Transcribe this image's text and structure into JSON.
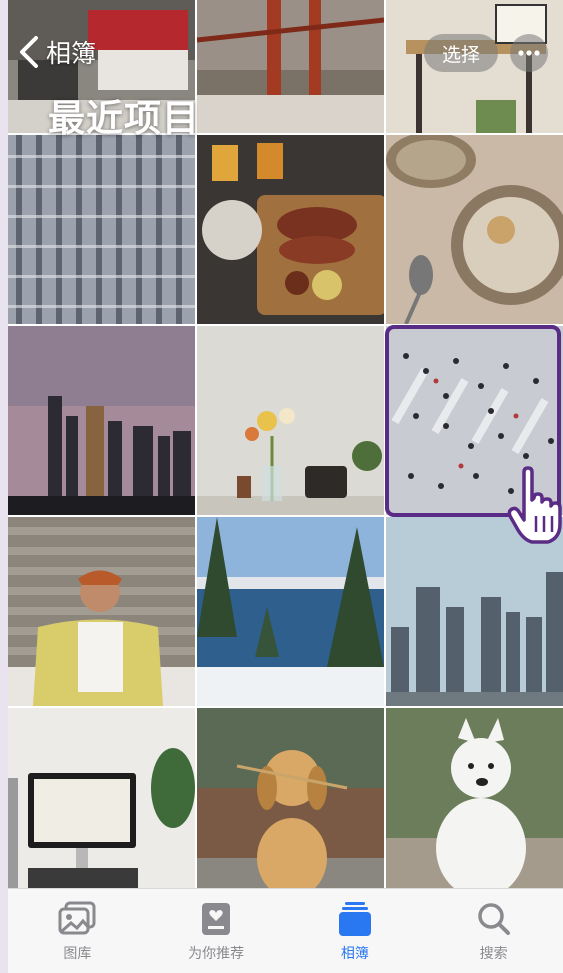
{
  "header": {
    "back_label": "相簿",
    "title": "最近项目",
    "select_label": "选择"
  },
  "tabs": [
    {
      "label": "图库",
      "icon": "photo-library-icon",
      "active": false
    },
    {
      "label": "为你推荐",
      "icon": "for-you-icon",
      "active": false
    },
    {
      "label": "相簿",
      "icon": "albums-icon",
      "active": true
    },
    {
      "label": "搜索",
      "icon": "search-icon",
      "active": false
    }
  ],
  "photos": [
    "food-grill",
    "golden-gate-bridge",
    "desk-tablet",
    "apartment-building",
    "sausage-platter",
    "mushroom-soup",
    "city-skyline-fence",
    "flower-vase-radio",
    "crowd-crosswalk",
    "woman-portrait",
    "lake-pine-trees",
    "skyscrapers",
    "home-office-desk",
    "golden-retriever",
    "samoyed-dog"
  ],
  "colors": {
    "accent": "#2a77f2",
    "highlight_border": "#5a2c86",
    "tab_inactive": "#8a8a8e"
  }
}
